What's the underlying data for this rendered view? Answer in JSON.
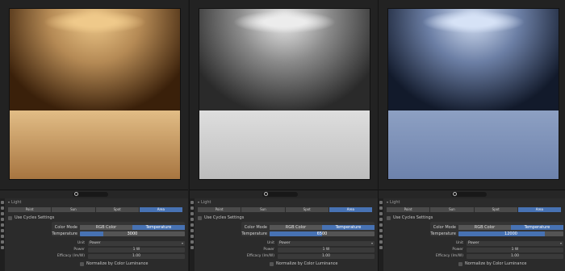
{
  "panels": [
    {
      "id": "warm",
      "colors": {
        "wall_top": "#3a200a",
        "light_core": "#efc98a",
        "floor_top": "#e2bd86",
        "floor_bottom": "#a77540",
        "wall_mid": "#b58a55"
      },
      "section_title": "Light",
      "light_types": [
        "Point",
        "Sun",
        "Spot",
        "Area"
      ],
      "active_type": 3,
      "use_cycles": "Use Cycles Settings",
      "color_mode_label": "Color Mode",
      "color_modes": [
        "RGB Color",
        "Temperature"
      ],
      "temperature_label": "Temperature",
      "temperature_value": "3000",
      "temperature_fill": 0.0,
      "unit_label": "Unit",
      "unit_value": "Power",
      "power_label": "Power",
      "power_value": "1 W",
      "efficacy_label": "Efficacy (lm/W)",
      "efficacy_value": "1.00",
      "normalize_label": "Normalize by Color Luminance"
    },
    {
      "id": "neutral",
      "colors": {
        "wall_top": "#2a2a2a",
        "light_core": "#ececec",
        "floor_top": "#dedede",
        "floor_bottom": "#bdbdbd",
        "wall_mid": "#8a8a8a"
      },
      "section_title": "Light",
      "light_types": [
        "Point",
        "Sun",
        "Spot",
        "Area"
      ],
      "active_type": 3,
      "use_cycles": "Use Cycles Settings",
      "color_mode_label": "Color Mode",
      "color_modes": [
        "RGB Color",
        "Temperature"
      ],
      "temperature_label": "Temperature",
      "temperature_value": "6500",
      "temperature_fill": 0.5,
      "unit_label": "Unit",
      "unit_value": "Power",
      "power_label": "Power",
      "power_value": "1 W",
      "efficacy_label": "Efficacy (lm/W)",
      "efficacy_value": "1.00",
      "normalize_label": "Normalize by Color Luminance"
    },
    {
      "id": "cool",
      "colors": {
        "wall_top": "#121a2b",
        "light_core": "#d6e2f6",
        "floor_top": "#8da0c3",
        "floor_bottom": "#6d82ac",
        "wall_mid": "#6c7fa5"
      },
      "section_title": "Light",
      "light_types": [
        "Point",
        "Sun",
        "Spot",
        "Area"
      ],
      "active_type": 3,
      "use_cycles": "Use Cycles Settings",
      "color_mode_label": "Color Mode",
      "color_modes": [
        "RGB Color",
        "Temperature"
      ],
      "temperature_label": "Temperature",
      "temperature_value": "12000",
      "temperature_fill": 0.82,
      "unit_label": "Unit",
      "unit_value": "Power",
      "power_label": "Power",
      "power_value": "1 W",
      "efficacy_label": "Efficacy (lm/W)",
      "efficacy_value": "1.00",
      "normalize_label": "Normalize by Color Luminance"
    }
  ],
  "accent_color": "#4772b3",
  "icons": [
    "search-icon",
    "properties-tab-icon"
  ]
}
